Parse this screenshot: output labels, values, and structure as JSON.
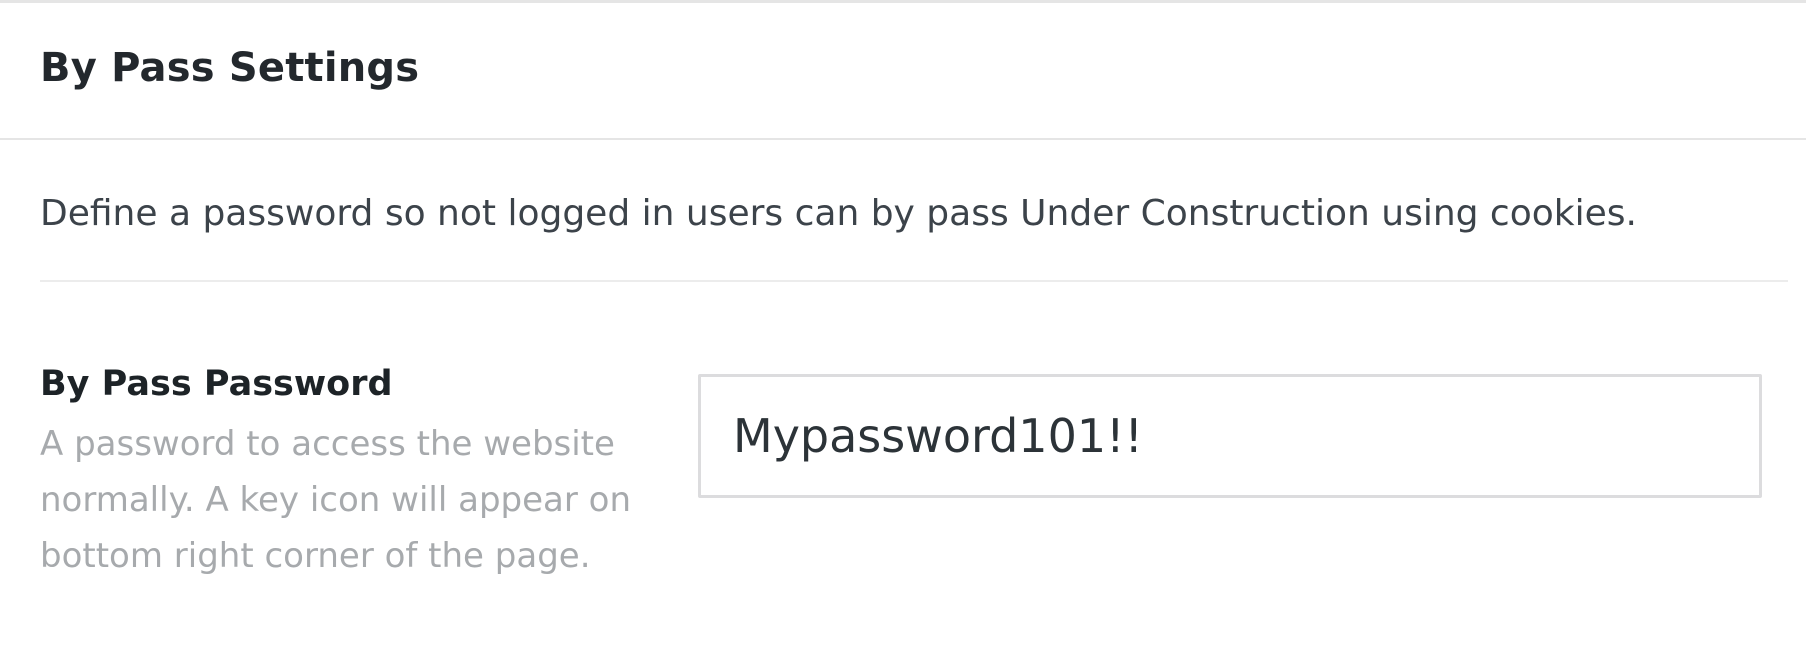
{
  "panel": {
    "title": "By Pass Settings",
    "description": "Define a password so not logged in users can by pass Under Construction using cookies."
  },
  "bypass_password": {
    "label": "By Pass Password",
    "help": "A password to access the website normally. A key icon will appear on bottom right corner of the page.",
    "value": "Mypassword101!!",
    "placeholder": ""
  },
  "colors": {
    "border": "#e5e5e5",
    "title_text": "#23282d",
    "help_text": "#a7aaad",
    "input_border": "#dcdcde"
  }
}
